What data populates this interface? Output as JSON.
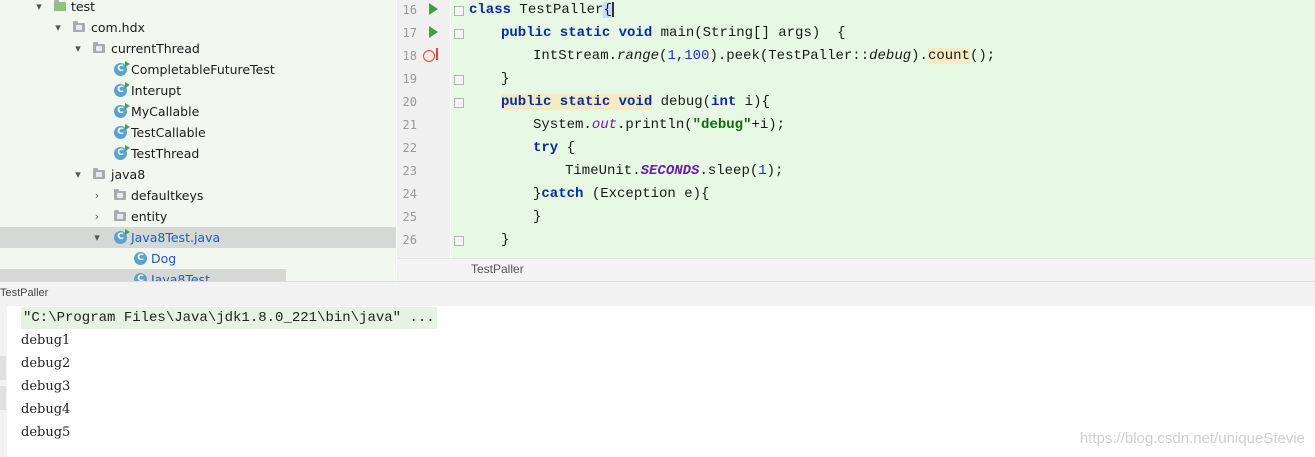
{
  "tree": {
    "items": [
      {
        "label": "test",
        "kind": "folder",
        "expanded": true
      },
      {
        "label": "com.hdx",
        "kind": "folder",
        "expanded": true
      },
      {
        "label": "currentThread",
        "kind": "folder",
        "expanded": true
      },
      {
        "label": "CompletableFutureTest",
        "kind": "class"
      },
      {
        "label": "Interupt",
        "kind": "class"
      },
      {
        "label": "MyCallable",
        "kind": "class"
      },
      {
        "label": "TestCallable",
        "kind": "class"
      },
      {
        "label": "TestThread",
        "kind": "class"
      },
      {
        "label": "java8",
        "kind": "folder",
        "expanded": true
      },
      {
        "label": "defaultkeys",
        "kind": "folder",
        "expanded": false
      },
      {
        "label": "entity",
        "kind": "folder",
        "expanded": false
      },
      {
        "label": "Java8Test.java",
        "kind": "file",
        "expanded": true,
        "selected": true
      },
      {
        "label": "Dog",
        "kind": "class"
      },
      {
        "label": "Java8Test",
        "kind": "class"
      }
    ],
    "class_icon_letter": "C"
  },
  "editor": {
    "line_numbers": [
      "16",
      "17",
      "18",
      "19",
      "20",
      "21",
      "22",
      "23",
      "24",
      "25",
      "26"
    ],
    "l16": {
      "kw": "class",
      "name": " TestPaller",
      "brace": "{"
    },
    "l17": {
      "kw": "public static void",
      "rest": " main(String[] args)  {"
    },
    "l18": {
      "a": "IntStream.",
      "range": "range",
      "b": "(",
      "n1": "1",
      "c": ",",
      "n2": "100",
      "d": ").peek(TestPaller::",
      "dbg": "debug",
      "e": ").",
      "count": "count",
      "f": "();"
    },
    "l19": {
      "text": "}"
    },
    "l20": {
      "kw": "public static void",
      "a": " debug(",
      "kw2": "int",
      "b": " i){"
    },
    "l21": {
      "a": "System.",
      "out": "out",
      "b": ".println(",
      "str": "\"debug\"",
      "c": "+i);"
    },
    "l22": {
      "kw": "try",
      "b": " {"
    },
    "l23": {
      "a": "TimeUnit.",
      "sec": "SECONDS",
      "b": ".sleep(",
      "n": "1",
      "c": ");"
    },
    "l24": {
      "a": "}",
      "kw": "catch",
      "b": " (Exception e){"
    },
    "l25": {
      "text": "}"
    },
    "l26": {
      "text": "}"
    },
    "breadcrumb": "TestPaller"
  },
  "run": {
    "title": "TestPaller",
    "command": "\"C:\\Program Files\\Java\\jdk1.8.0_221\\bin\\java\" ...",
    "output": [
      "debug1",
      "debug2",
      "debug3",
      "debug4",
      "debug5"
    ]
  },
  "watermark": "https://blog.csdn.net/uniqueStevie"
}
